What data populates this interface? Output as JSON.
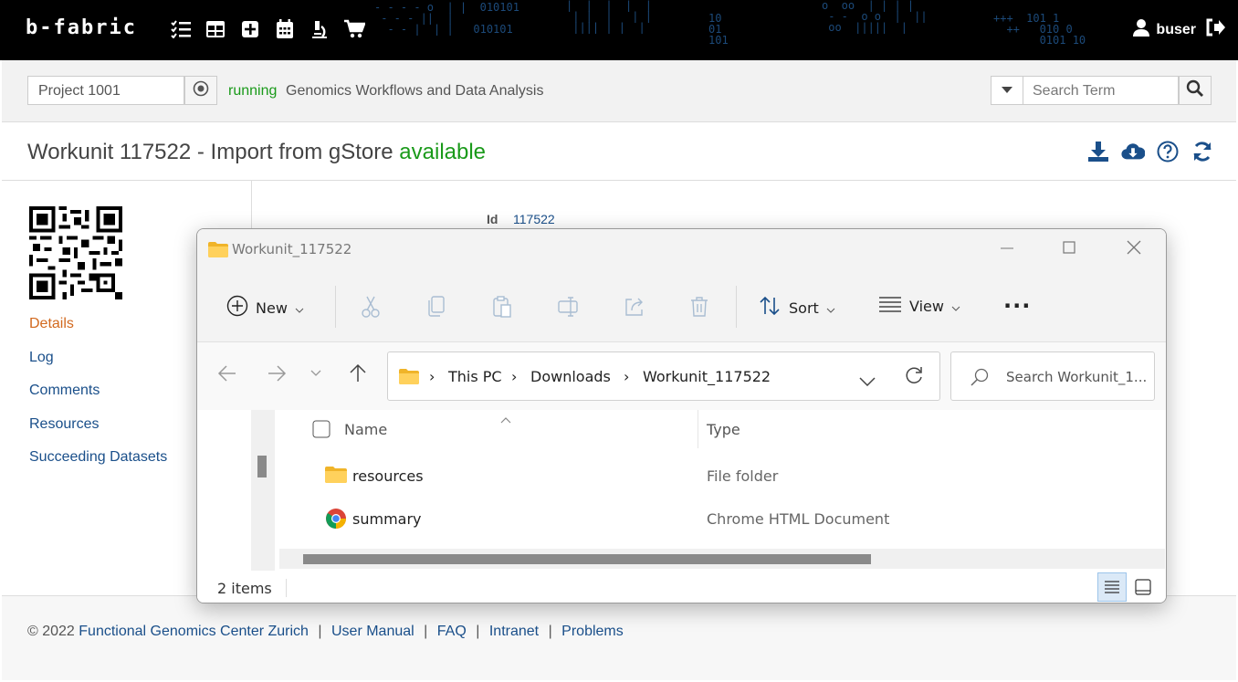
{
  "app": {
    "logo": "b-fabric",
    "user": "buser"
  },
  "project": {
    "value": "Project 1001",
    "status": "running",
    "name": "Genomics Workflows and Data Analysis"
  },
  "search": {
    "placeholder": "Search Term"
  },
  "page": {
    "title": "Workunit 117522 - Import from gStore",
    "status": "available"
  },
  "sidebar": {
    "items": [
      {
        "label": "Details"
      },
      {
        "label": "Log"
      },
      {
        "label": "Comments"
      },
      {
        "label": "Resources"
      },
      {
        "label": "Succeeding Datasets"
      }
    ]
  },
  "details": {
    "id_label": "Id",
    "id_value": "117522"
  },
  "explorer": {
    "title": "Workunit_117522",
    "toolbar": {
      "new_label": "New",
      "sort_label": "Sort",
      "view_label": "View",
      "more_label": "..."
    },
    "breadcrumb": [
      "This PC",
      "Downloads",
      "Workunit_117522"
    ],
    "search_placeholder": "Search Workunit_1...",
    "columns": {
      "name": "Name",
      "type": "Type"
    },
    "files": [
      {
        "name": "resources",
        "type": "File folder",
        "icon": "folder-icon"
      },
      {
        "name": "summary",
        "type": "Chrome HTML Document",
        "icon": "chrome-icon"
      }
    ],
    "item_count": "2 items"
  },
  "footer": {
    "copyright": "© 2022",
    "org": "Functional Genomics Center Zurich",
    "links": [
      "User Manual",
      "FAQ",
      "Intranet",
      "Problems"
    ]
  },
  "colors": {
    "accent": "#1a4f8a",
    "status_green": "#1a9a1a",
    "active_nav": "#d2691e"
  }
}
